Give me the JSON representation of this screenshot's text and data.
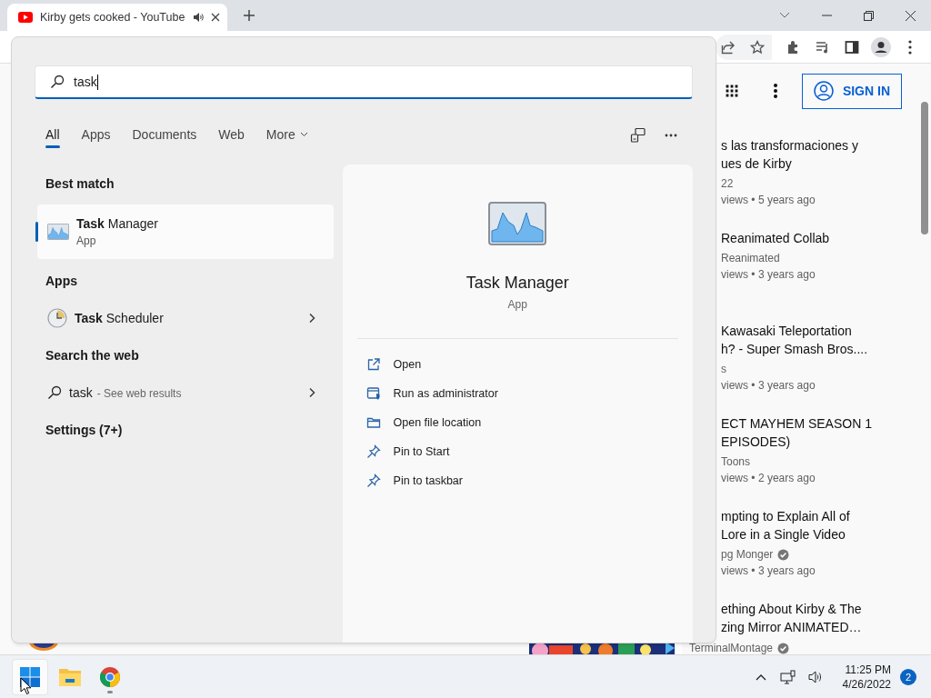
{
  "browser": {
    "tab": {
      "title": "Kirby gets cooked - YouTube",
      "audio": true
    }
  },
  "youtube": {
    "sign_in": "SIGN IN",
    "videos": [
      {
        "title_lines": [
          "s las transformaciones y",
          "ues de Kirby"
        ],
        "channel": "22",
        "verified": false,
        "meta": "views • 5 years ago"
      },
      {
        "title_lines": [
          "Reanimated Collab"
        ],
        "channel": "Reanimated",
        "verified": false,
        "meta": "views • 3 years ago"
      },
      {
        "title_lines": [
          "Kawasaki Teleportation",
          "h? - Super Smash Bros...."
        ],
        "channel": "s",
        "verified": false,
        "meta": "views • 3 years ago"
      },
      {
        "title_lines": [
          "ECT MAYHEM SEASON 1",
          "EPISODES)"
        ],
        "channel": "Toons",
        "verified": false,
        "meta": "views • 2 years ago"
      },
      {
        "title_lines": [
          "mpting to Explain All of",
          "Lore in a Single Video"
        ],
        "channel": "pg Monger",
        "verified": true,
        "meta": "views • 3 years ago"
      },
      {
        "title_lines": [
          "ething About Kirby & The",
          "zing Mirror ANIMATED…"
        ]
      }
    ],
    "bottom_channel": {
      "name": "TerminalMontage",
      "verified": true
    }
  },
  "flyout": {
    "query": "task",
    "tabs": [
      {
        "label": "All",
        "selected": true,
        "kind": "tab"
      },
      {
        "label": "Apps",
        "selected": false,
        "kind": "tab"
      },
      {
        "label": "Documents",
        "selected": false,
        "kind": "tab"
      },
      {
        "label": "Web",
        "selected": false,
        "kind": "tab"
      },
      {
        "label": "More",
        "selected": false,
        "kind": "menu"
      }
    ],
    "sections": [
      {
        "heading": "Best match",
        "items": [
          {
            "kind": "best",
            "title": "**Task** Manager",
            "subtitle": "App",
            "selected": true
          }
        ]
      },
      {
        "heading": "Apps",
        "items": [
          {
            "kind": "app",
            "title": "**Task** Scheduler",
            "selected": false
          }
        ]
      },
      {
        "heading": "Search the web",
        "items": [
          {
            "kind": "web",
            "query": "task",
            "hint": "- See web results",
            "selected": false
          }
        ]
      },
      {
        "heading": "Settings (7+)"
      }
    ],
    "preview": {
      "title": "Task Manager",
      "subtitle": "App",
      "actions": [
        {
          "kind": "open",
          "label": "Open"
        },
        {
          "kind": "admin",
          "label": "Run as administrator"
        },
        {
          "kind": "folder",
          "label": "Open file location"
        },
        {
          "kind": "pin",
          "label": "Pin to Start"
        },
        {
          "kind": "pin",
          "label": "Pin to taskbar"
        }
      ]
    }
  },
  "taskbar": {
    "apps": [
      {
        "kind": "start",
        "active": true,
        "running": false
      },
      {
        "kind": "explorer",
        "active": false,
        "running": false
      },
      {
        "kind": "chrome",
        "active": false,
        "running": true
      }
    ],
    "time": "11:25 PM",
    "date": "4/26/2022",
    "notifications": "2"
  }
}
